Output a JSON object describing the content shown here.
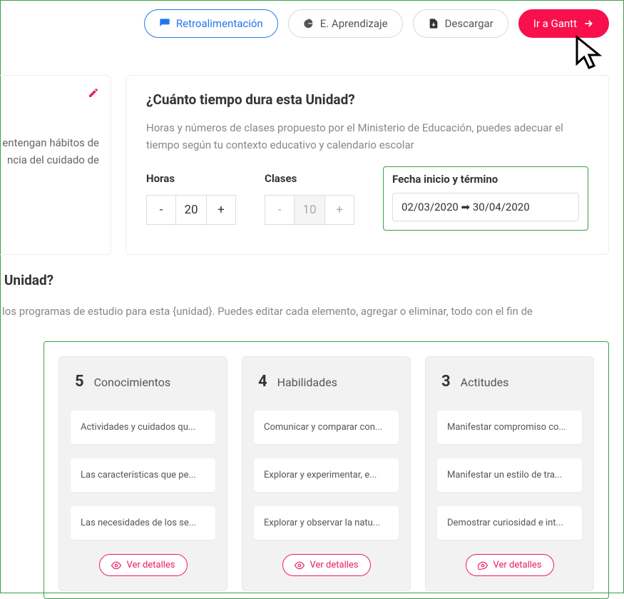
{
  "toolbar": {
    "feedback_label": "Retroalimentación",
    "learning_label": "E. Aprendizaje",
    "download_label": "Descargar",
    "gantt_label": "Ir a Gantt"
  },
  "side": {
    "text": "entengan hábitos de ncia del cuidado de"
  },
  "duration_card": {
    "title": "¿Cuánto tiempo dura esta Unidad?",
    "desc": "Horas y números de clases propuesto por el Ministerio de Educación, puedes adecuar el tiempo según tu contexto educativo y calendario escolar",
    "hours_label": "Horas",
    "hours_value": "20",
    "classes_label": "Clases",
    "classes_value": "10",
    "date_label": "Fecha inicio y término",
    "date_value": "02/03/2020 ➡ 30/04/2020",
    "minus": "-",
    "plus": "+"
  },
  "section2": {
    "title": "a Unidad?",
    "desc": "g los programas de estudio para esta {unidad}. Puedes editar cada elemento, agregar o eliminar, todo con el fin de"
  },
  "columns": [
    {
      "count": "5",
      "title": "Conocimientos",
      "items": [
        "Actividades y cuidados qu...",
        "Las características que pe...",
        "Las necesidades de los se..."
      ]
    },
    {
      "count": "4",
      "title": "Habilidades",
      "items": [
        "Comunicar y comparar con...",
        "Explorar y experimentar, e...",
        "Explorar y observar la natu..."
      ]
    },
    {
      "count": "3",
      "title": "Actitudes",
      "items": [
        "Manifestar compromiso co...",
        "Manifestar un estilo de tra...",
        "Demostrar curiosidad e int..."
      ]
    }
  ],
  "details_label": "Ver detalles"
}
